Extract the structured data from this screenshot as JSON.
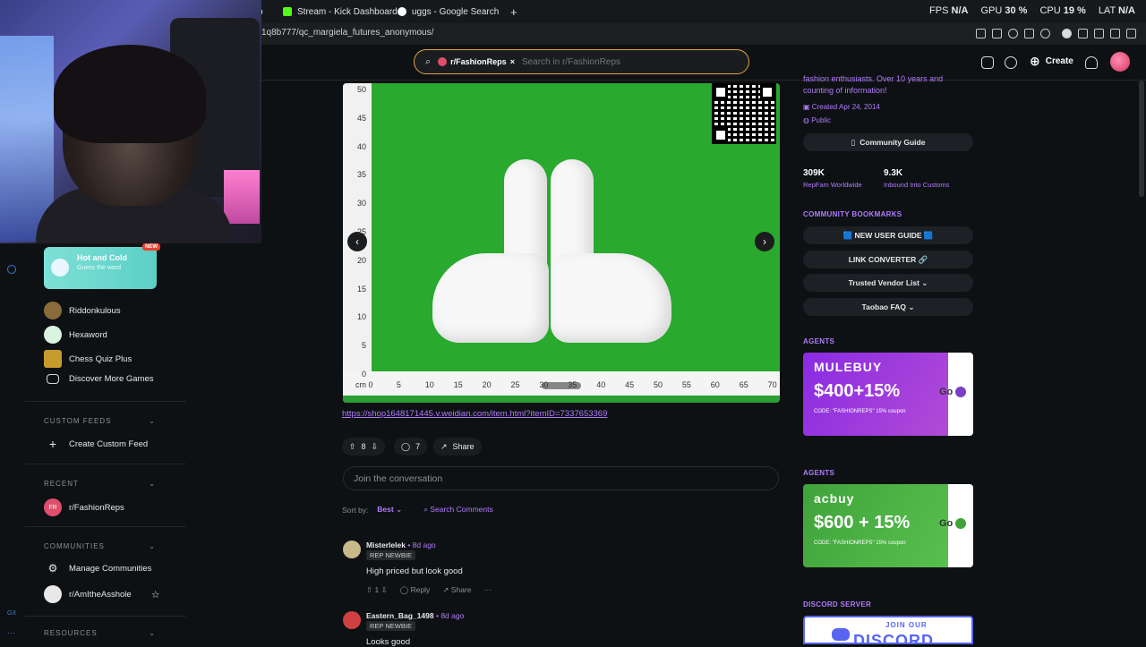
{
  "browser": {
    "tabs": [
      {
        "label": "p"
      },
      {
        "label": "Stream - Kick Dashboard"
      },
      {
        "label": "uggs - Google Search"
      }
    ],
    "new_tab": "+",
    "stats": {
      "fps_label": "FPS",
      "fps": "N/A",
      "gpu_label": "GPU",
      "gpu": "30 %",
      "cpu_label": "CPU",
      "cpu": "19 %",
      "lat_label": "LAT",
      "lat": "N/A"
    },
    "url": "1q8b777/qc_margiela_futures_anonymous/"
  },
  "header": {
    "search_chip": "r/FashionReps",
    "search_chip_close": "×",
    "search_placeholder": "Search in r/FashionReps",
    "create_label": "Create"
  },
  "promo": {
    "title": "Hot and Cold",
    "subtitle": "Guess the word",
    "badge": "NEW"
  },
  "games": [
    {
      "label": "Riddonkulous"
    },
    {
      "label": "Hexaword"
    },
    {
      "label": "Chess Quiz Plus"
    },
    {
      "label": "Discover More Games"
    }
  ],
  "custom_feeds": {
    "heading": "CUSTOM FEEDS",
    "create": "Create Custom Feed"
  },
  "recent": {
    "heading": "RECENT",
    "items": [
      {
        "label": "r/FashionReps",
        "avatar": "FR"
      }
    ]
  },
  "communities": {
    "heading": "COMMUNITIES",
    "manage": "Manage Communities",
    "items": [
      {
        "label": "r/AmItheAsshole"
      }
    ]
  },
  "resources": {
    "heading": "RESOURCES"
  },
  "post": {
    "ruler_v": [
      "50",
      "45",
      "40",
      "35",
      "30",
      "25",
      "20",
      "15",
      "10",
      "5",
      "0"
    ],
    "ruler_h": [
      "cm 0",
      "5",
      "10",
      "15",
      "20",
      "25",
      "30",
      "35",
      "40",
      "45",
      "50",
      "55",
      "60",
      "65",
      "70"
    ],
    "link": "https://shop1648171445.v.weidian.com/item.html?itemID=7337653369",
    "votes": "8",
    "comments": "7",
    "share": "Share",
    "join_placeholder": "Join the conversation",
    "sort_label": "Sort by:",
    "sort_value": "Best",
    "search_comments": "Search Comments"
  },
  "comments": [
    {
      "user": "Misterlelek",
      "age": "• 8d ago",
      "flair": "REP NEWBIE",
      "body": "High priced but look good",
      "votes": "1",
      "reply": "Reply",
      "share": "Share",
      "more": "···"
    },
    {
      "user": "Eastern_Bag_1498",
      "age": "• 8d ago",
      "flair": "REP NEWBIE",
      "body": "Looks good"
    }
  ],
  "sidebar_right": {
    "desc": "fashion enthusiasts. Over 10 years and counting of information!",
    "created": "Created Apr 24, 2014",
    "visibility": "Public",
    "guide": "Community Guide",
    "stats": [
      {
        "value": "309K",
        "label": "RepFam Worldwide"
      },
      {
        "value": "9.3K",
        "label": "Inbound Into Customs"
      }
    ],
    "bookmarks_heading": "COMMUNITY BOOKMARKS",
    "bookmarks": [
      {
        "label": "🟦 NEW USER GUIDE 🟦"
      },
      {
        "label": "LINK CONVERTER 🔗"
      },
      {
        "label": "Trusted Vendor List ⌄"
      },
      {
        "label": "Taobao FAQ ⌄"
      }
    ],
    "agents_heading": "AGENTS",
    "ads": [
      {
        "brand": "MULEBUY",
        "price": "$400+15%",
        "code": "CODE: \"FASHIONREPS\" 15% coupon",
        "go": "Go"
      },
      {
        "brand": "acbuy",
        "price": "$600 + 15%",
        "code": "CODE: \"FASHIONREPS\" 15% coupon",
        "go": "Go"
      }
    ],
    "discord_heading": "DISCORD SERVER",
    "discord_join": "JOIN OUR",
    "discord_word": "DISCORD"
  }
}
